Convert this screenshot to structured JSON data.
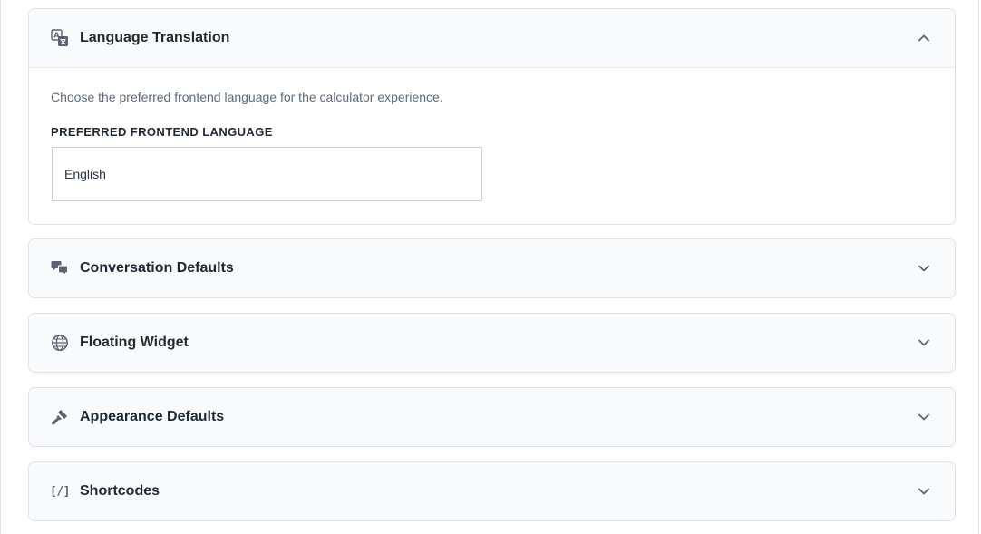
{
  "panels": [
    {
      "title": "Language Translation",
      "icon": "translate-icon",
      "expanded": true,
      "description": "Choose the preferred frontend language for the calculator experience.",
      "field_label": "PREFERRED FRONTEND LANGUAGE",
      "selected_language": "English"
    },
    {
      "title": "Conversation Defaults",
      "icon": "chat-bubbles-icon",
      "expanded": false
    },
    {
      "title": "Floating Widget",
      "icon": "globe-icon",
      "expanded": false
    },
    {
      "title": "Appearance Defaults",
      "icon": "brush-icon",
      "expanded": false
    },
    {
      "title": "Shortcodes",
      "icon": "shortcode-icon",
      "icon_text": "[/]",
      "expanded": false
    }
  ],
  "colors": {
    "panel_bg": "#f8fafc",
    "panel_border": "#dfe3e8",
    "title_text": "#1f2933",
    "icon": "#5b6470",
    "muted_text": "#5f6b77"
  }
}
